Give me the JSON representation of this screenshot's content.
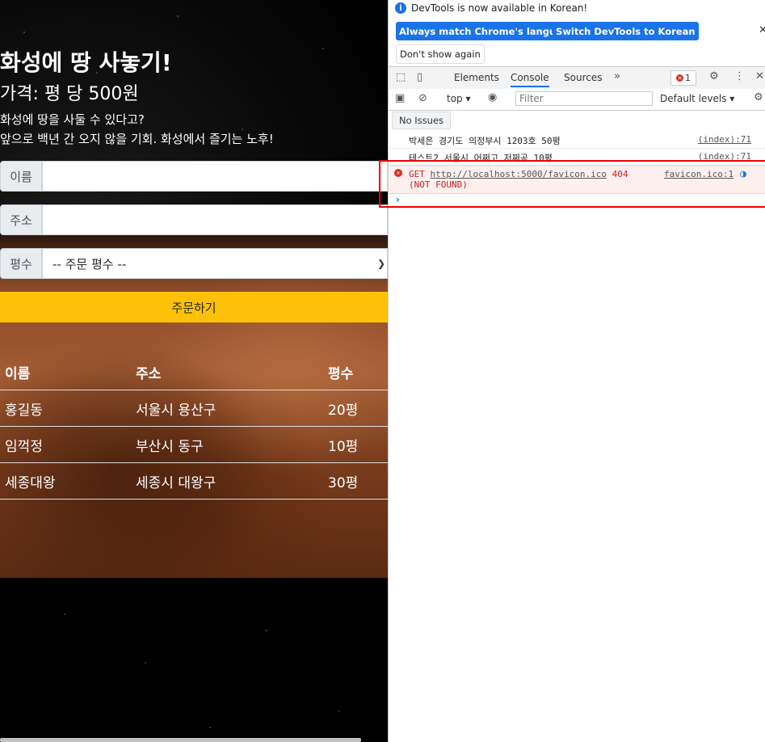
{
  "page": {
    "title": "화성에 땅 사놓기!",
    "price": "가격: 평 당 500원",
    "desc1": "화성에 땅을 사둘 수 있다고?",
    "desc2": "앞으로 백년 간 오지 않을 기회. 화성에서 즐기는 노후!",
    "form": {
      "name_label": "이름",
      "address_label": "주소",
      "size_label": "평수",
      "size_selected": "-- 주문 평수 --",
      "order_button": "주문하기"
    },
    "table": {
      "headers": [
        "이름",
        "주소",
        "평수"
      ],
      "rows": [
        [
          "홍길동",
          "서울시 용산구",
          "20평"
        ],
        [
          "임꺽정",
          "부산시 동구",
          "10평"
        ],
        [
          "세종대왕",
          "세종시 대왕구",
          "30평"
        ]
      ]
    }
  },
  "devtools": {
    "info_text": "DevTools is now available in Korean!",
    "btn_match": "Always match Chrome's language",
    "btn_switch": "Switch DevTools to Korean",
    "btn_dont_show": "Don't show again",
    "tabs": [
      "Elements",
      "Console",
      "Sources"
    ],
    "active_tab": "Console",
    "error_count": "1",
    "context": "top",
    "filter_placeholder": "Filter",
    "levels": "Default levels",
    "no_issues": "No Issues",
    "logs": [
      {
        "msg": "박세은 경기도 의정부시 1203호 50평",
        "src": "(index):71"
      },
      {
        "msg": "테스트2 서울시 어쩌고 저쩌공 10평",
        "src": "(index):71"
      }
    ],
    "error": {
      "method": "GET",
      "url": "http://localhost:5000/favicon.ico",
      "status": "404 (NOT FOUND)",
      "src": "favicon.ico:1"
    }
  }
}
